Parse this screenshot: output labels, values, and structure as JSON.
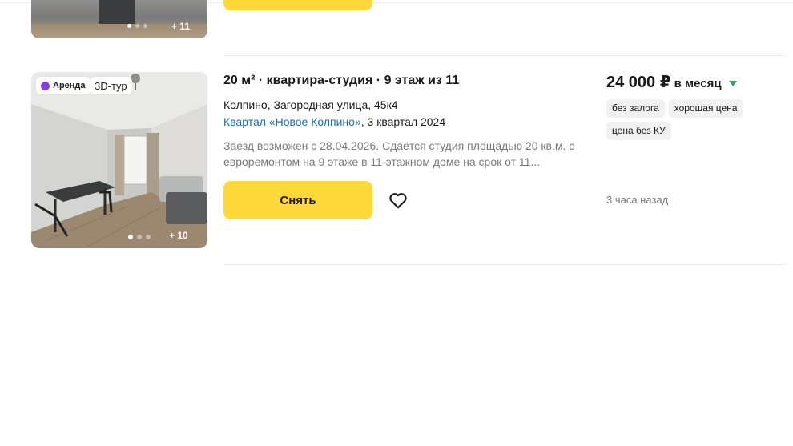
{
  "previous_listing": {
    "photo_more_count": "+ 11"
  },
  "listing": {
    "badges": {
      "rent": "Аренда",
      "tour": "3D-тур"
    },
    "photo_more_count": "+ 10",
    "title": "20 м² · квартира-студия · 9 этаж из 11",
    "address": "Колпино, Загородная улица, 45к4",
    "complex_link": "Квартал «Новое Колпино»",
    "complex_completion": ", 3 квартал 2024",
    "description": "Заезд возможен с 28.04.2026. Сдаётся студия площадью 20 кв.м. с евроремонтом на 9 этаже в 11-этажном доме на срок от 11...",
    "rent_button_label": "Снять",
    "price": {
      "amount": "24 000 ₽",
      "period": "в месяц"
    },
    "tags": [
      "без залога",
      "хорошая цена",
      "цена без КУ"
    ],
    "published": "3 часа назад"
  },
  "icons": {
    "favorite": "heart-outline-icon",
    "price_trend": "price-down-triangle-icon",
    "rent_badge": "rent-dot-icon"
  },
  "colors": {
    "accent_button": "#ffd83b",
    "link": "#1a6fa6",
    "price_trend": "#2fa84f",
    "rent_badge_icon": "#8b3ee6",
    "tag_bg": "#f1f1f1",
    "muted_text": "#7a7a7a"
  }
}
